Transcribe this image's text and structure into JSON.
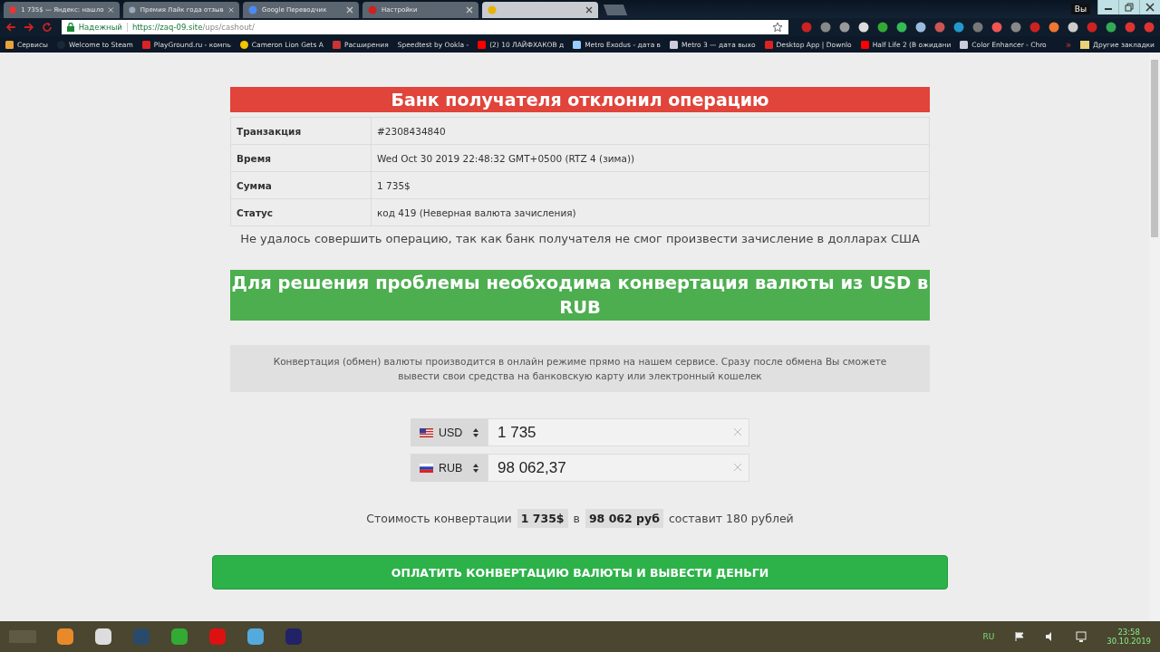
{
  "browser": {
    "tabs": [
      {
        "title": "1 735$ — Яндекс: нашло",
        "selected": false
      },
      {
        "title": "Премия Лайк года отзыв",
        "selected": false
      },
      {
        "title": "Google Переводчик",
        "selected": false
      },
      {
        "title": "Настройки",
        "selected": false
      },
      {
        "selected": true
      }
    ],
    "profile": "Вы",
    "address": {
      "secure_label": "Надежный",
      "host": "https://zaq-09.site",
      "path": "/ups/cashout/"
    },
    "bookmarks": [
      {
        "label": "Сервисы"
      },
      {
        "label": "Welcome to Steam"
      },
      {
        "label": "PlayGround.ru - компь"
      },
      {
        "label": "Cameron Lion Gets A"
      },
      {
        "label": "Расширения"
      },
      {
        "label": "Speedtest by Ookla -"
      },
      {
        "label": "(2) 10 ЛАЙФХАКОВ д"
      },
      {
        "label": "Metro Exodus - дата в"
      },
      {
        "label": "Metro 3 — дата выхо"
      },
      {
        "label": "Desktop App | Downlo"
      },
      {
        "label": "Half Life 2 (В ожидани"
      },
      {
        "label": "Color Enhancer - Chro"
      }
    ],
    "more_bookmarks": "»",
    "other_bookmarks": "Другие закладки"
  },
  "page": {
    "error_title": "Банк получателя отклонил операцию",
    "details": [
      {
        "label": "Транзакция",
        "value": "#2308434840"
      },
      {
        "label": "Время",
        "value": "Wed Oct 30 2019 22:48:32 GMT+0500 (RTZ 4 (зима))"
      },
      {
        "label": "Сумма",
        "value": "1 735$"
      },
      {
        "label": "Статус",
        "value": "код 419 (Неверная валюта зачисления)"
      }
    ],
    "message": "Не удалось совершить операцию, так как банк получателя не смог произвести зачисление в долларах США",
    "solution_title": "Для решения проблемы необходима конвертация валюты из USD в RUB",
    "info": "Конвертация (обмен) валюты производится в онлайн режиме прямо на нашем сервисе. Сразу после обмена Вы сможете вывести свои средства на банковскую карту или электронный кошелек",
    "converter": [
      {
        "currency": "USD",
        "amount": "1 735"
      },
      {
        "currency": "RUB",
        "amount": "98 062,37"
      }
    ],
    "cost": {
      "prefix": "Стоимость конвертации",
      "from": "1 735$",
      "middle": "в",
      "to": "98 062 руб",
      "suffix": "составит 180 рублей"
    },
    "pay_button": "ОПЛАТИТЬ КОНВЕРТАЦИЮ ВАЛЮТЫ И ВЫВЕСТИ ДЕНЬГИ"
  },
  "taskbar": {
    "language": "RU",
    "time": "23:58",
    "date": "30.10.2019"
  }
}
